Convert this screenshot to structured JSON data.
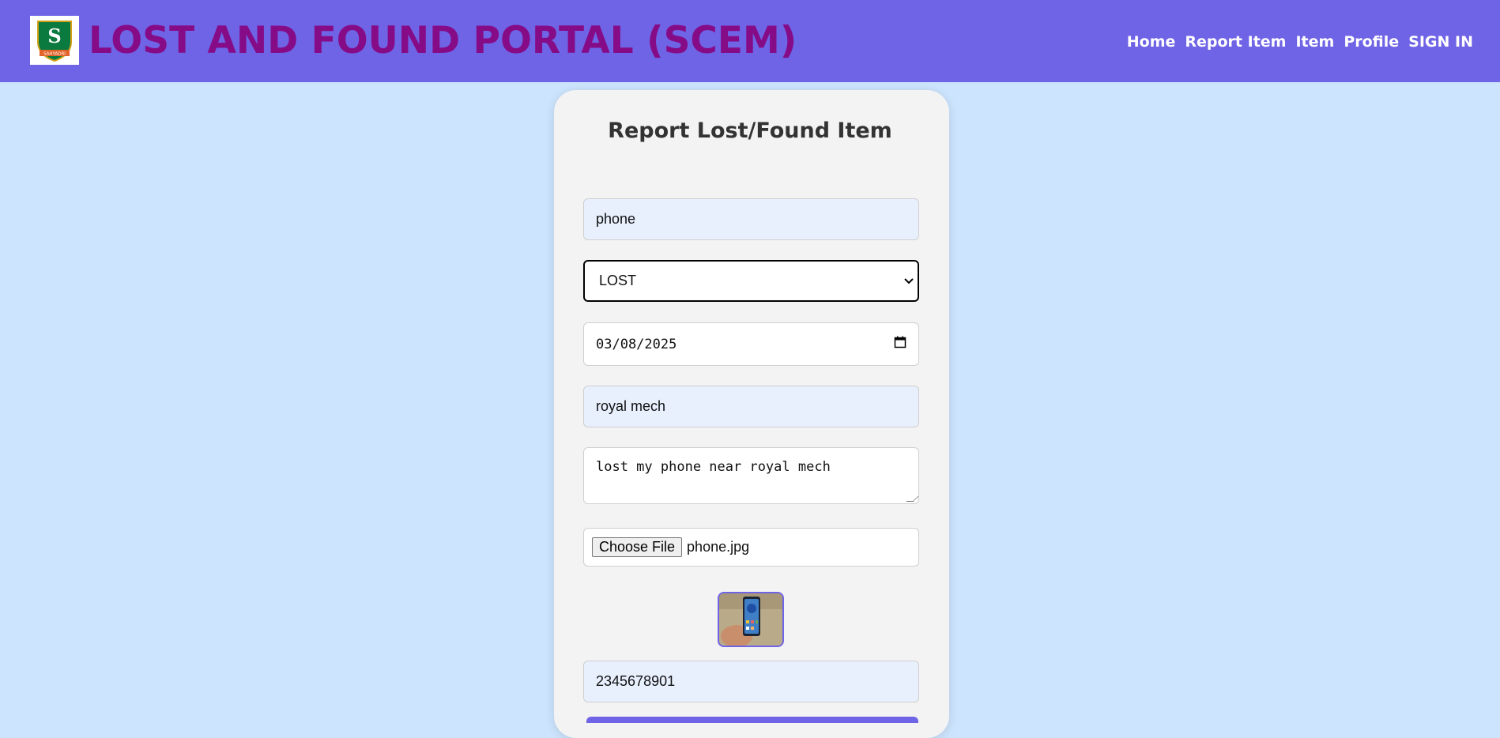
{
  "header": {
    "title": "LOST AND FOUND PORTAL (SCEM)",
    "logo_letter": "S",
    "logo_band_text": "SAHYADRI",
    "nav": [
      "Home",
      "Report Item",
      "Item",
      "Profile",
      "SIGN IN"
    ]
  },
  "form": {
    "heading": "Report Lost/Found Item",
    "item_name": "phone",
    "status": "LOST",
    "date": "03/08/2025",
    "location": "royal mech",
    "description": "lost my phone near royal mech",
    "file_button": "Choose File",
    "file_name": "phone.jpg",
    "phone": "2345678901"
  },
  "colors": {
    "navbar": "#6f63e6",
    "title": "#860b86",
    "background": "#cce4fd",
    "card": "#f3f3f3"
  }
}
